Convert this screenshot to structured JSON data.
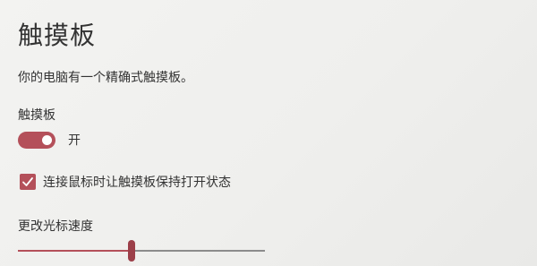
{
  "page": {
    "title": "触摸板",
    "description": "你的电脑有一个精确式触摸板。"
  },
  "touchpad_toggle": {
    "label": "触摸板",
    "state_text": "开",
    "on": true
  },
  "mouse_connected_option": {
    "label": "连接鼠标时让触摸板保持打开状态",
    "checked": true
  },
  "cursor_speed": {
    "label": "更改光标速度",
    "value_fraction": 0.46
  },
  "colors": {
    "accent": "#b4505a",
    "accent_dark": "#9c3f49"
  },
  "icons": {
    "checkbox_mark": "checkmark-icon"
  }
}
